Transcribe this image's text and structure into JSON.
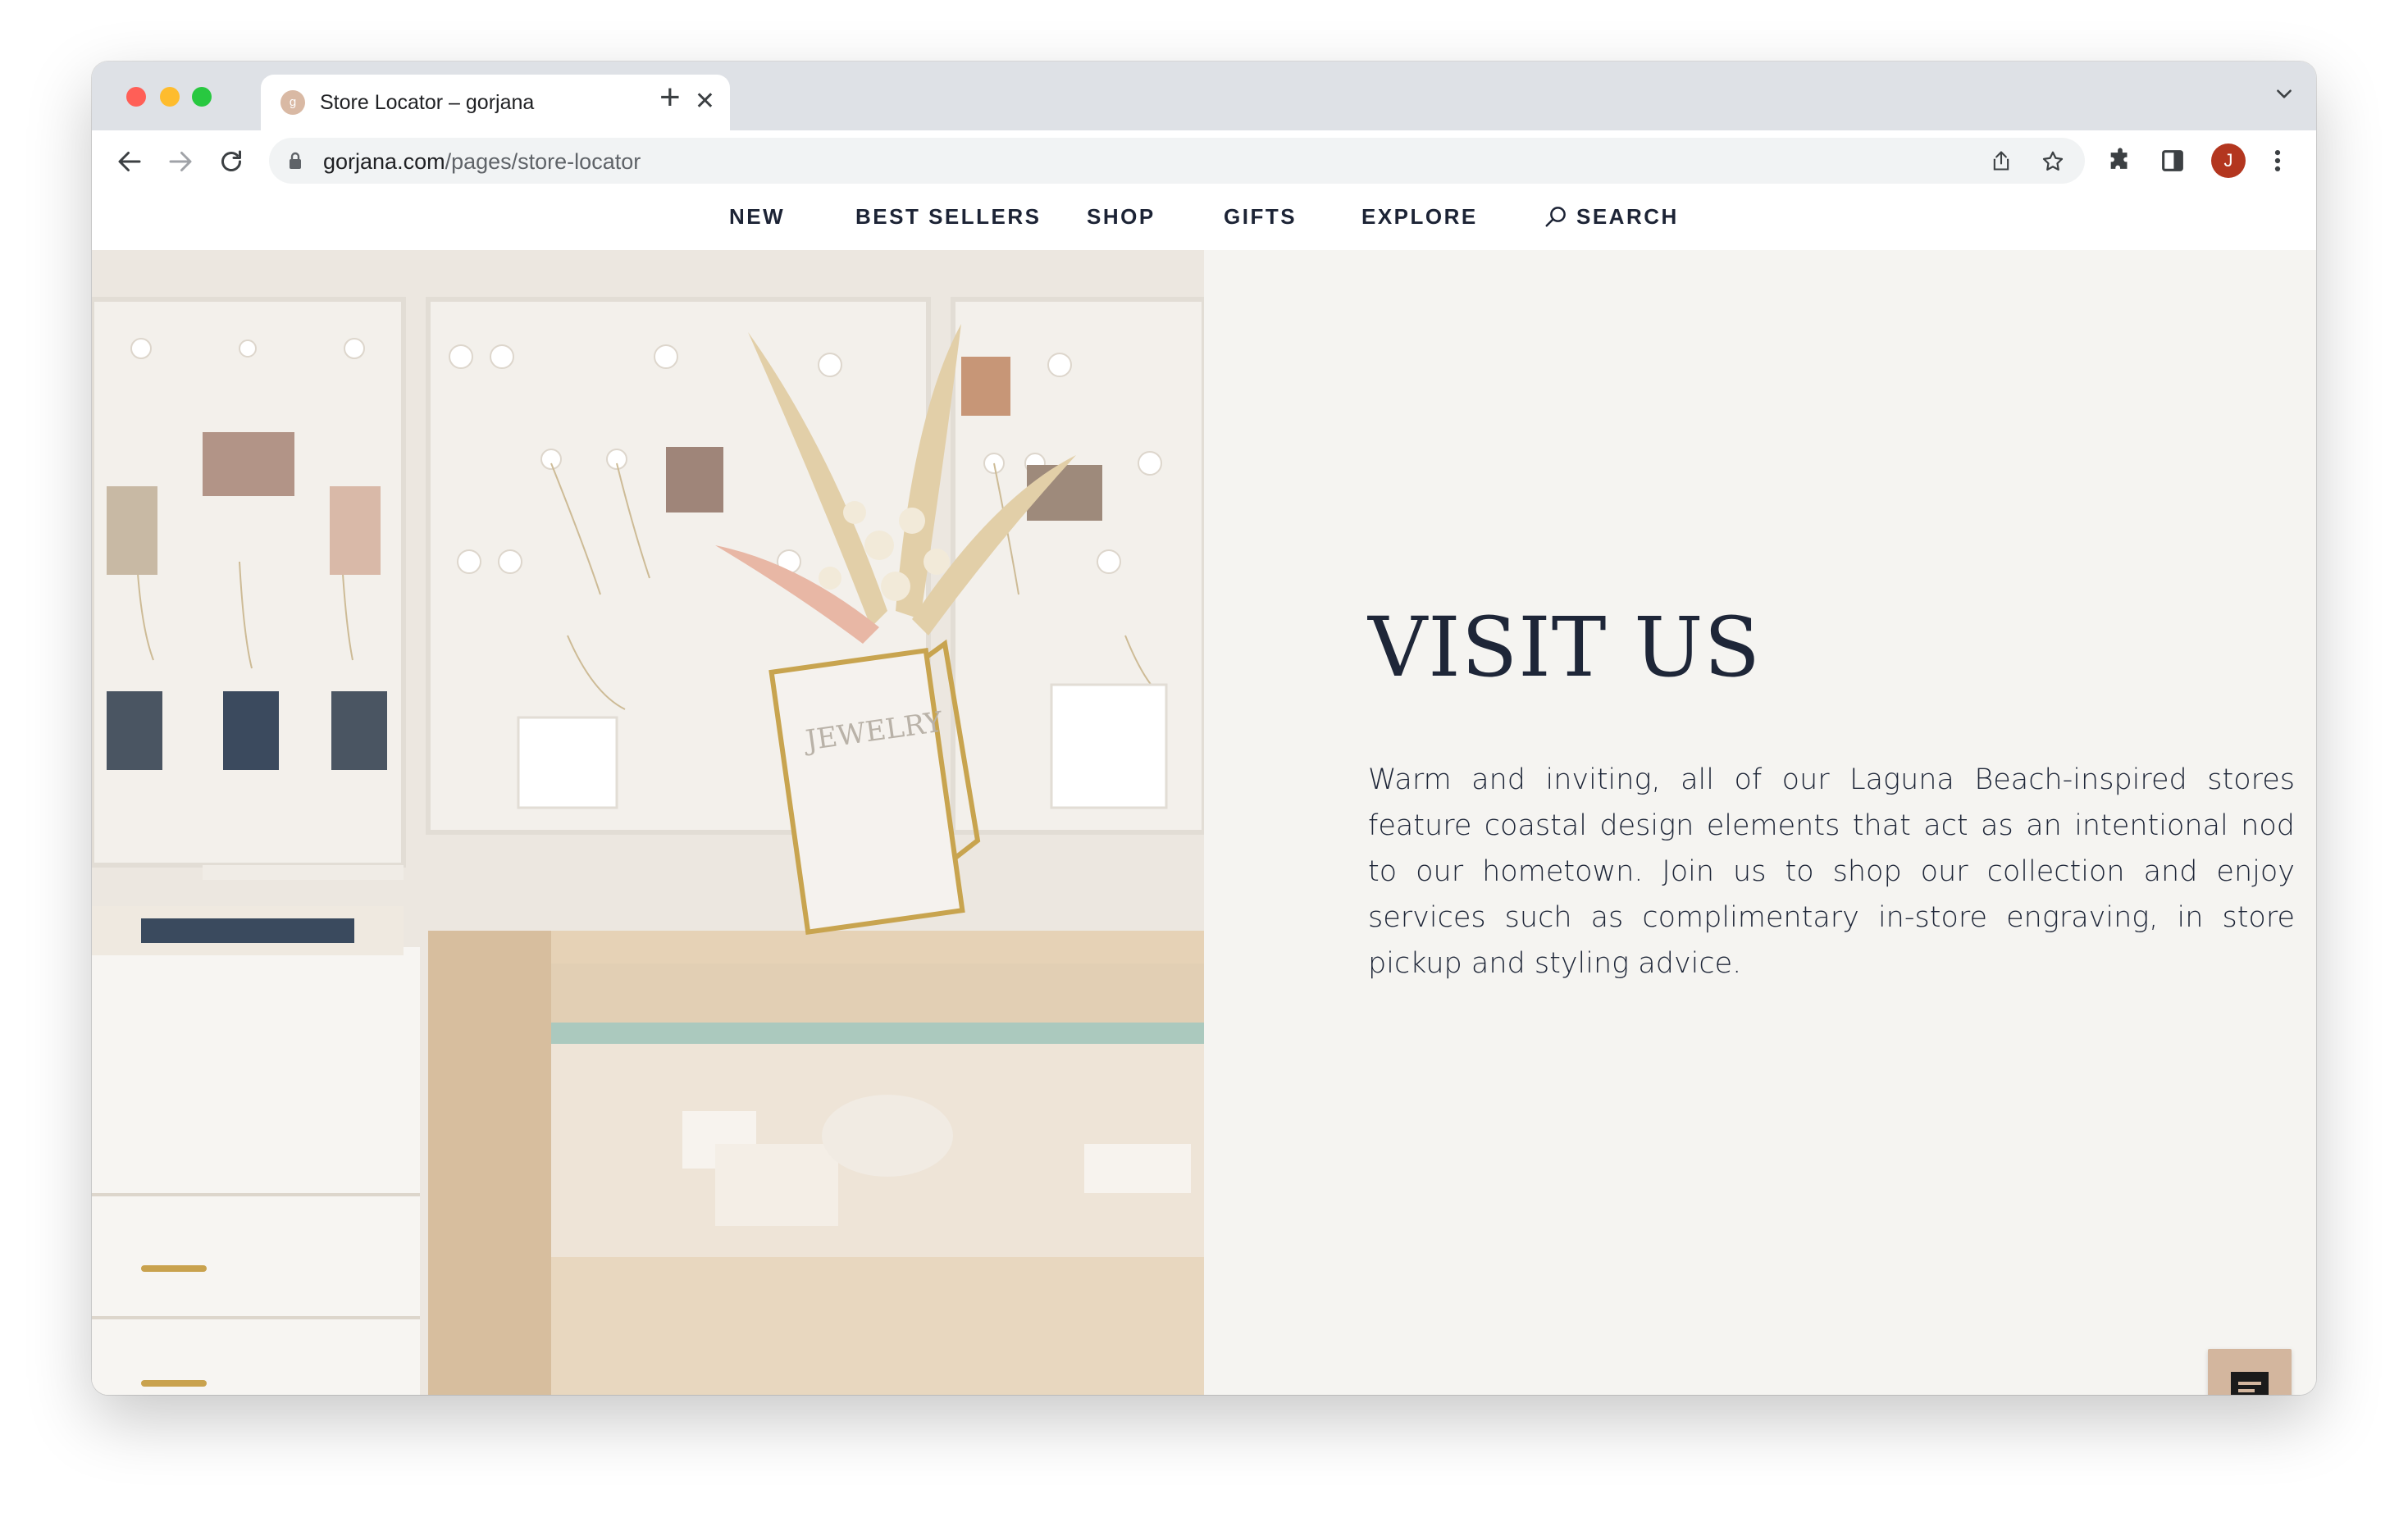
{
  "browser": {
    "tab_title": "Store Locator – gorjana",
    "tab_favicon_letter": "g",
    "url_host": "gorjana.com",
    "url_path": "/pages/store-locator",
    "profile_initial": "J"
  },
  "site_nav": {
    "items": [
      "NEW",
      "BEST SELLERS",
      "SHOP",
      "GIFTS",
      "EXPLORE"
    ],
    "search_label": "SEARCH"
  },
  "hero": {
    "heading": "VISIT US",
    "body": "Warm and inviting, all of our Laguna Beach-inspired stores feature coastal design elements that act as an intentional nod to our hometown. Join us to shop our collection and enjoy services such as complimentary in-store engraving, in store pickup and styling advice.",
    "image_frame_text": "JEWELRY"
  },
  "colors": {
    "text_dark": "#1e2638",
    "page_bg": "#f5f4f1",
    "chat_button": "#d3b69e",
    "avatar": "#b3361f"
  },
  "icons": [
    "back-arrow-icon",
    "forward-arrow-icon",
    "reload-icon",
    "lock-icon",
    "share-icon",
    "star-icon",
    "extensions-icon",
    "sidebar-icon",
    "kebab-menu-icon",
    "search-icon",
    "chat-icon",
    "close-icon",
    "plus-icon",
    "chevron-down-icon"
  ]
}
